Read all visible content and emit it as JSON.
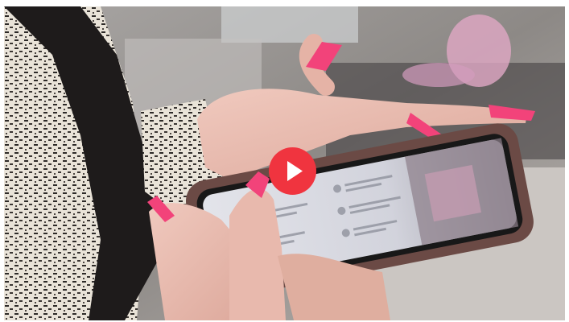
{
  "video": {
    "colors": {
      "play_button": "#f0343f",
      "play_icon": "#ffffff",
      "nails": "#f2437a",
      "phone_case": "#6b4a45",
      "screen": "#dcdde6"
    },
    "icons": {
      "play": "play-icon"
    }
  }
}
